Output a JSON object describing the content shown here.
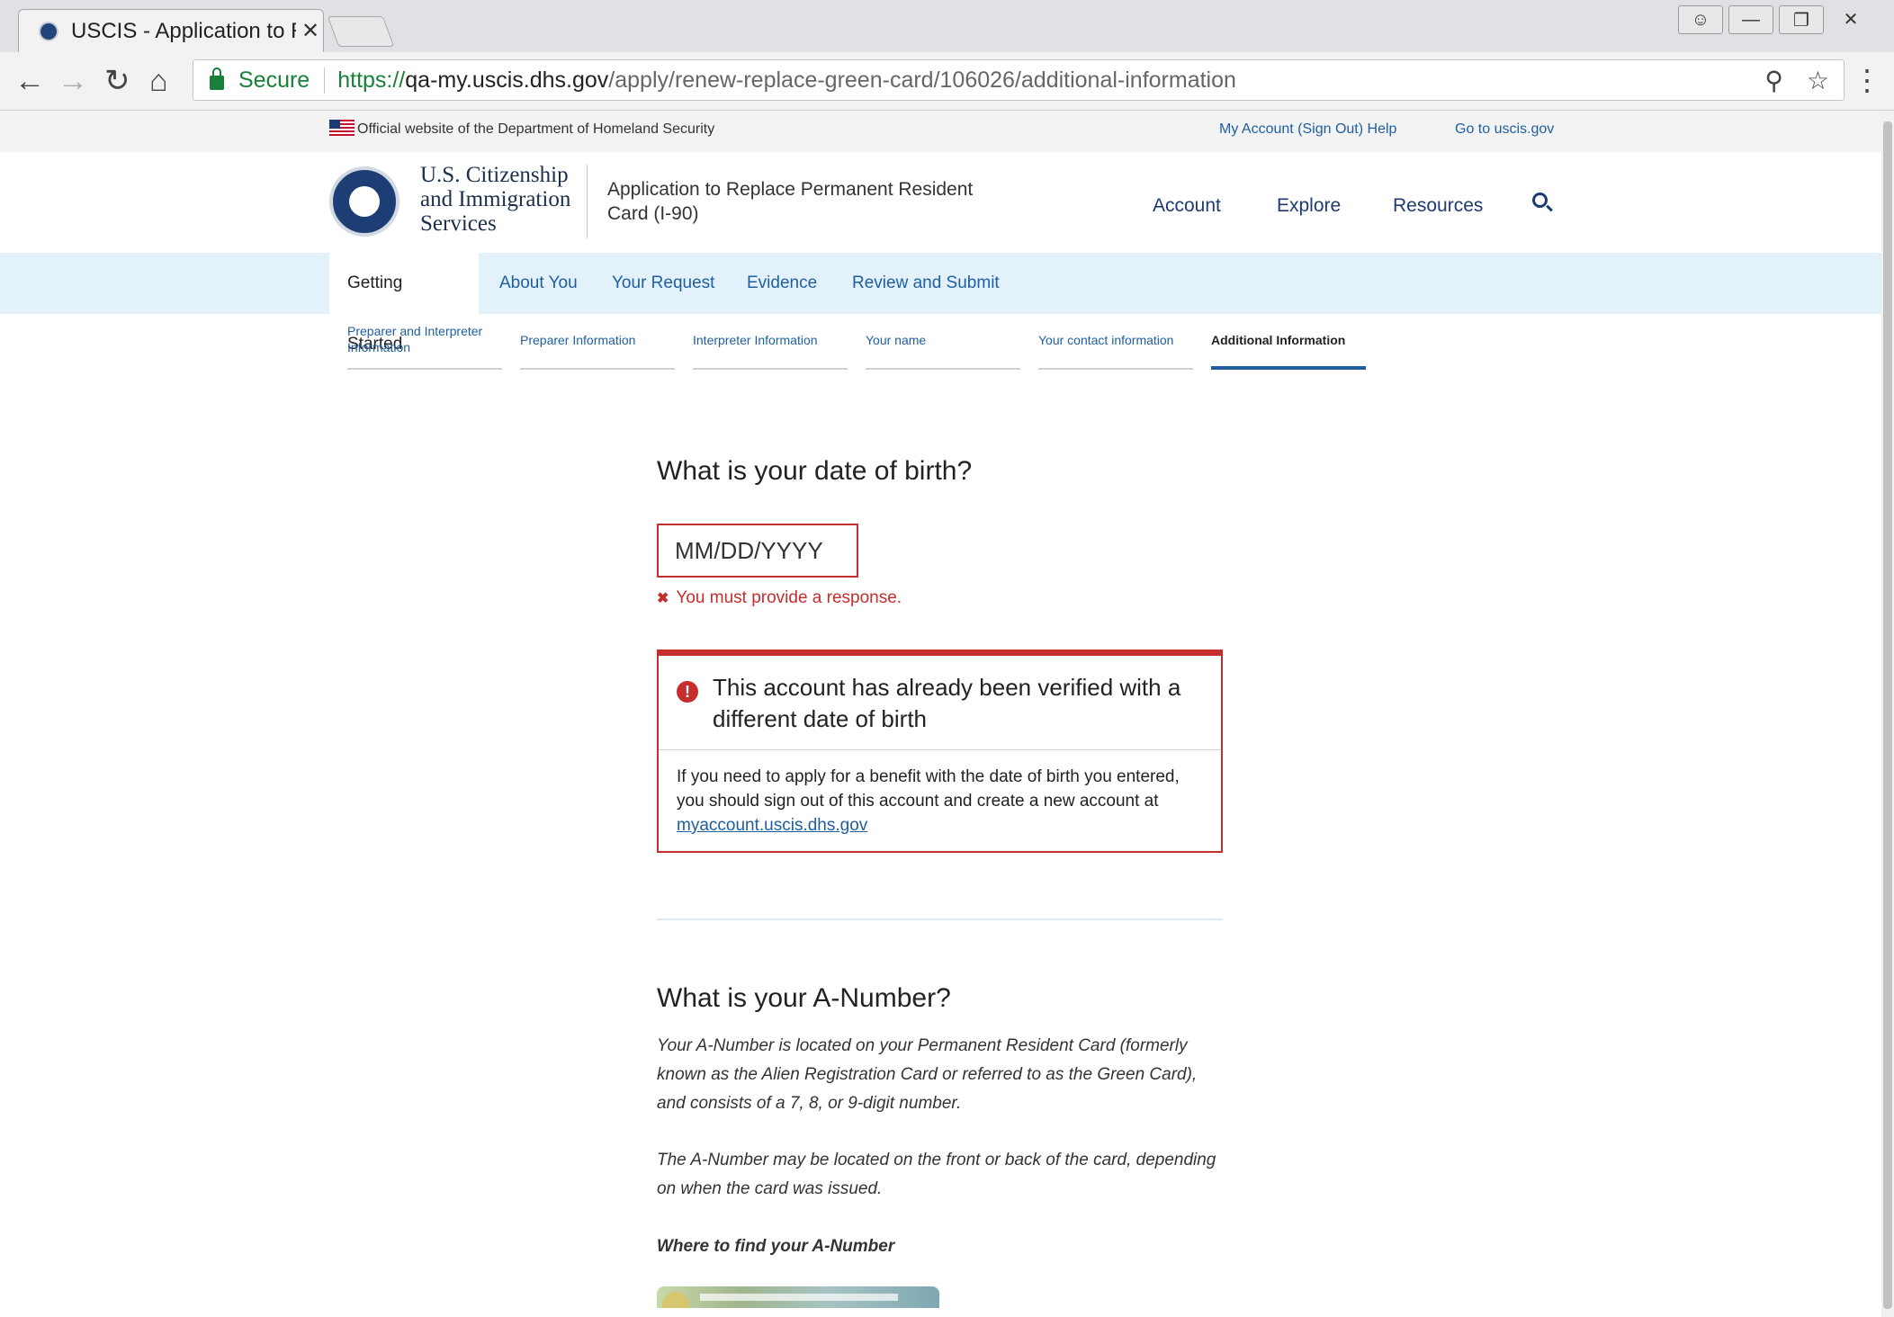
{
  "browser": {
    "tab_title": "USCIS - Application to Re",
    "tab_close": "✕",
    "secure_label": "Secure",
    "url_scheme": "https://",
    "url_host": "qa-my.uscis.dhs.gov",
    "url_path": "/apply/renew-replace-green-card/106026/additional-information",
    "icons": [
      "back-icon",
      "forward-icon",
      "reload-icon",
      "home-icon",
      "lock-icon",
      "zoom-icon",
      "star-icon",
      "menu-icon",
      "profile-icon",
      "minimize-icon",
      "restore-icon",
      "close-icon"
    ]
  },
  "gov_banner": {
    "official_text": "Official website of the Department of Homeland Security",
    "my_account": "My Account",
    "sign_out": "(Sign Out)",
    "help": "Help",
    "goto": "Go to uscis.gov"
  },
  "header": {
    "agency_line1": "U.S. Citizenship",
    "agency_line2": "and Immigration",
    "agency_line3": "Services",
    "app_title": "Application to Replace Permanent Resident Card (I-90)",
    "nav": [
      "Account",
      "Explore",
      "Resources"
    ]
  },
  "steps": [
    "Getting Started",
    "About You",
    "Your Request",
    "Evidence",
    "Review and Submit"
  ],
  "active_step": "Getting Started",
  "substeps": [
    "Preparer and Interpreter Information",
    "Preparer Information",
    "Interpreter Information",
    "Your name",
    "Your contact information",
    "Additional Information"
  ],
  "active_substep": "Additional Information",
  "dob": {
    "question": "What is your date of birth?",
    "placeholder": "MM/DD/YYYY",
    "error": "You must provide a response."
  },
  "alert": {
    "title": "This account has already been verified with a different date of birth",
    "body": "If you need to apply for a benefit with the date of birth you entered, you should sign out of this account and create a new account at",
    "link": "myaccount.uscis.dhs.gov"
  },
  "anumber": {
    "question": "What is your A-Number?",
    "help1": "Your A-Number is located on your Permanent Resident Card (formerly known as the Alien Registration Card or referred to as the Green Card), and consists of a 7, 8, or 9-digit number.",
    "help2": "The A-Number may be located on the front or back of the card, depending on when the card was issued.",
    "where": "Where to find your A-Number"
  },
  "colors": {
    "error_red": "#c62d2d",
    "link_blue": "#1f5fa0",
    "steps_bg": "#e3f1fb",
    "navy": "#1f3a70"
  }
}
